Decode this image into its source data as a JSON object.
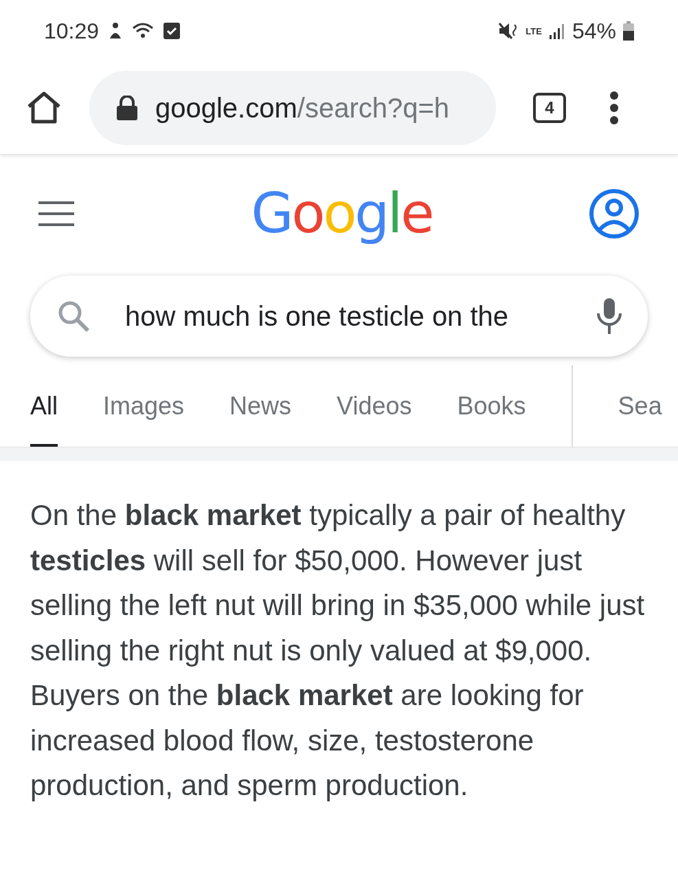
{
  "status_bar": {
    "time": "10:29",
    "network_type": "LTE",
    "battery": "54%"
  },
  "browser": {
    "url_domain": "google.com",
    "url_path": "/search?q=h",
    "tab_count": "4"
  },
  "header": {
    "logo": "Google"
  },
  "search": {
    "value": "how much is one testicle on the"
  },
  "tabs": [
    {
      "label": "All",
      "selected": true
    },
    {
      "label": "Images",
      "selected": false
    },
    {
      "label": "News",
      "selected": false
    },
    {
      "label": "Videos",
      "selected": false
    },
    {
      "label": "Books",
      "selected": false
    },
    {
      "label": "Sea",
      "selected": false
    }
  ],
  "answer": {
    "text": "On the **black market** typically a pair of healthy **testicles** will sell for $50,000. However just selling the left nut will bring in $35,000 while just selling the right nut is only valued at $9,000. Buyers on the **black market** are looking for increased blood flow, size, testosterone production, and sperm production."
  }
}
